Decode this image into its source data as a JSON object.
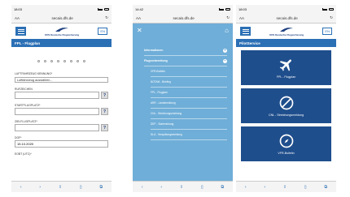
{
  "phone1": {
    "time": "18:03",
    "url_text_size": "AA",
    "url": "secais.dfs.de",
    "logo_text": "Deutsche Flugsicherung",
    "logo_brand": "DFS",
    "lang_button": "EN",
    "title": "FPL - Flugplan",
    "fields": {
      "aircraft_id_label": "LUFTFAHRZEUG KENNUNG*",
      "aircraft_id_value": "Luftfahrzeug auswählen...",
      "callsign_label": "RUFZEICHEN",
      "departure_label": "STARTFLUGPLATZ*",
      "destination_label": "ZIELFLUGPLATZ*",
      "dof_label": "DOF*",
      "dof_value": "15.10.2020",
      "eobt_label": "EOBT (UTC)*"
    },
    "help_glyph": "?"
  },
  "phone2": {
    "time": "14:42",
    "url_text_size": "AA",
    "url": "secais.dfs.de",
    "close_glyph": "✕",
    "home_glyph": "⌂",
    "menu": [
      {
        "label": "Informationen",
        "bold": true,
        "expand": "+"
      },
      {
        "label": "Flugvorbereitung",
        "bold": true,
        "expand": "−"
      }
    ],
    "submenu": [
      "VFR-Bulletin",
      "NOTAM - Briefing",
      "FPL - Flugplan",
      "ARR - Landemeldung",
      "CNL - Streichungsmeldung",
      "DEP - Startmeldung",
      "DLA - Verspätungsmeldung"
    ]
  },
  "phone3": {
    "time": "18:03",
    "url_text_size": "AA",
    "url": "secais.dfs.de",
    "lang_button": "EN",
    "logo_text": "Deutsche Flugsicherung",
    "logo_brand": "DFS",
    "title": "PilotService",
    "tiles": [
      {
        "label": "FPL - Flugplan",
        "icon": "airplane-icon"
      },
      {
        "label": "CNL - Streichungsmeldung",
        "icon": "cancel-icon"
      },
      {
        "label": "VFR-Bulletin",
        "icon": "compass-icon"
      }
    ]
  },
  "colors": {
    "primary": "#2b6fb5",
    "menu_bg": "#6faed8",
    "tile_bg": "#1f4e8c"
  }
}
